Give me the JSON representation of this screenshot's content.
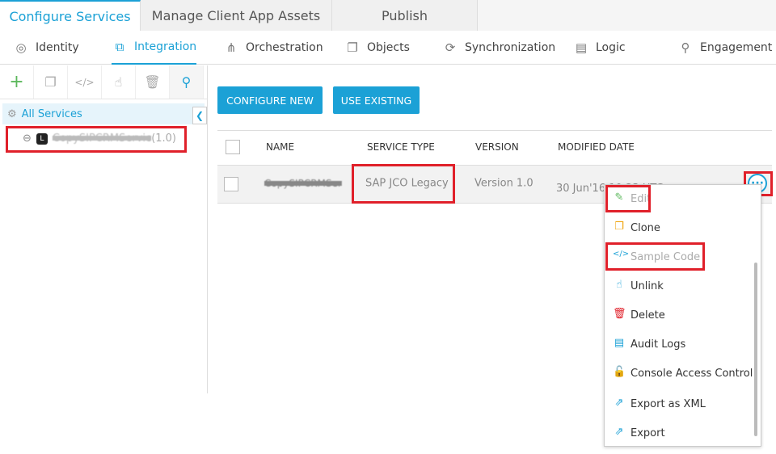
{
  "top_tabs": [
    "Configure Services",
    "Manage Client App Assets",
    "Publish"
  ],
  "sub_nav": [
    {
      "label": "Identity",
      "icon": "fingerprint-icon"
    },
    {
      "label": "Integration",
      "icon": "integration-icon"
    },
    {
      "label": "Orchestration",
      "icon": "orchestration-icon"
    },
    {
      "label": "Objects",
      "icon": "objects-icon"
    },
    {
      "label": "Synchronization",
      "icon": "sync-icon"
    },
    {
      "label": "Logic",
      "icon": "logic-icon"
    },
    {
      "label": "Engagement",
      "icon": "engagement-icon"
    }
  ],
  "sidebar": {
    "all_services": "All Services",
    "service_name": "CopySIPCRMServic",
    "service_version": "(1.0)",
    "badge": "L"
  },
  "buttons": {
    "configure_new": "CONFIGURE NEW",
    "use_existing": "USE EXISTING"
  },
  "table": {
    "headers": [
      "NAME",
      "SERVICE TYPE",
      "VERSION",
      "MODIFIED DATE"
    ],
    "rows": [
      {
        "name": "CopySIPCRMSer",
        "type": "SAP JCO Legacy",
        "version": "Version 1.0",
        "modified": "30 Jun'16 10:23 UTC"
      }
    ]
  },
  "menu": [
    "Edit",
    "Clone",
    "Sample Code",
    "Unlink",
    "Delete",
    "Audit Logs",
    "Console Access Control",
    "Export as XML",
    "Export"
  ],
  "colors": {
    "accent": "#1ba1d6",
    "highlight": "#e0202a"
  }
}
